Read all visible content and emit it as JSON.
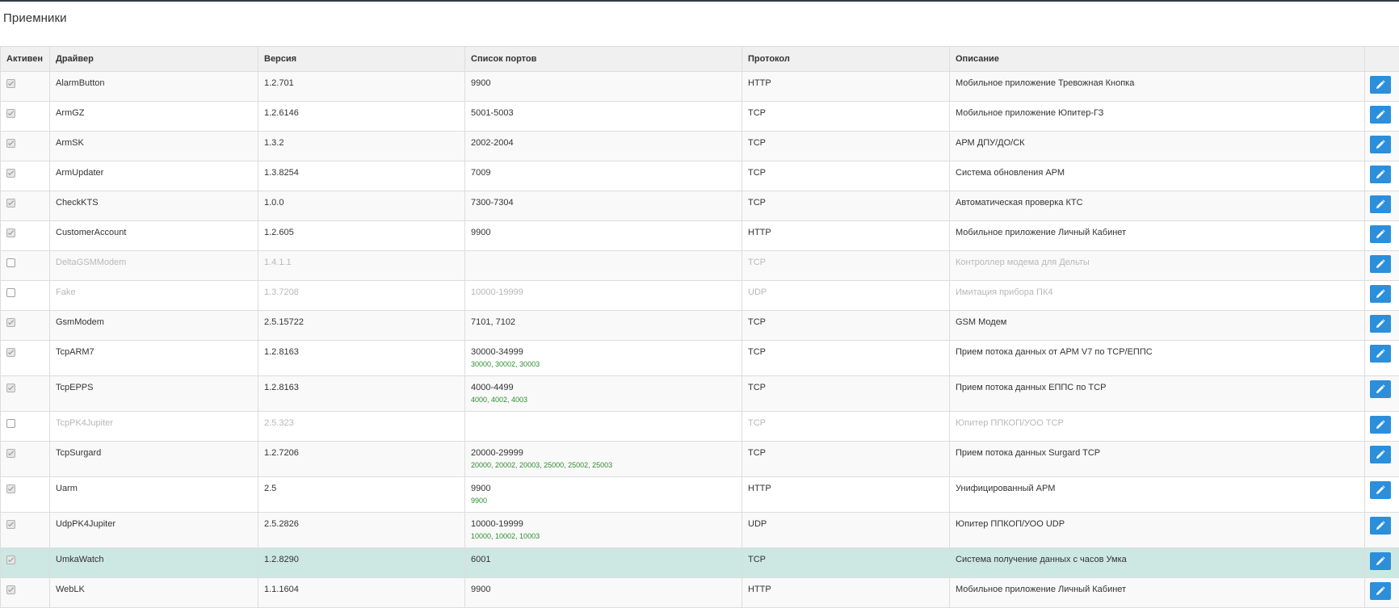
{
  "page": {
    "title": "Приемники"
  },
  "columns": [
    "Активен",
    "Драйвер",
    "Версия",
    "Список портов",
    "Протокол",
    "Описание",
    ""
  ],
  "colors": {
    "accent": "#2b8fdb",
    "highlight_row": "#cde7e3",
    "ports_active": "#2e8b2e"
  },
  "rows": [
    {
      "active": true,
      "driver": "AlarmButton",
      "version": "1.2.701",
      "ports": "9900",
      "ports_active": "",
      "protocol": "HTTP",
      "description": "Мобильное приложение Тревожная Кнопка"
    },
    {
      "active": true,
      "driver": "ArmGZ",
      "version": "1.2.6146",
      "ports": "5001-5003",
      "ports_active": "",
      "protocol": "TCP",
      "description": "Мобильное приложение Юпитер-ГЗ"
    },
    {
      "active": true,
      "driver": "ArmSK",
      "version": "1.3.2",
      "ports": "2002-2004",
      "ports_active": "",
      "protocol": "TCP",
      "description": "АРМ ДПУ/ДО/СК"
    },
    {
      "active": true,
      "driver": "ArmUpdater",
      "version": "1.3.8254",
      "ports": "7009",
      "ports_active": "",
      "protocol": "TCP",
      "description": "Система обновления АРМ"
    },
    {
      "active": true,
      "driver": "CheckKTS",
      "version": "1.0.0",
      "ports": "7300-7304",
      "ports_active": "",
      "protocol": "TCP",
      "description": "Автоматическая проверка КТС"
    },
    {
      "active": true,
      "driver": "CustomerAccount",
      "version": "1.2.605",
      "ports": "9900",
      "ports_active": "",
      "protocol": "HTTP",
      "description": "Мобильное приложение Личный Кабинет"
    },
    {
      "active": false,
      "driver": "DeltaGSMModem",
      "version": "1.4.1.1",
      "ports": "",
      "ports_active": "",
      "protocol": "TCP",
      "description": "Контроллер модема для Дельты"
    },
    {
      "active": false,
      "driver": "Fake",
      "version": "1.3.7208",
      "ports": "10000-19999",
      "ports_active": "",
      "protocol": "UDP",
      "description": "Имитация прибора ПК4"
    },
    {
      "active": true,
      "driver": "GsmModem",
      "version": "2.5.15722",
      "ports": "7101, 7102",
      "ports_active": "",
      "protocol": "TCP",
      "description": "GSM Модем"
    },
    {
      "active": true,
      "driver": "TcpARM7",
      "version": "1.2.8163",
      "ports": "30000-34999",
      "ports_active": "30000, 30002, 30003",
      "protocol": "TCP",
      "description": "Прием потока данных от АРМ V7 по TCP/ЕППС"
    },
    {
      "active": true,
      "driver": "TcpEPPS",
      "version": "1.2.8163",
      "ports": "4000-4499",
      "ports_active": "4000, 4002, 4003",
      "protocol": "TCP",
      "description": "Прием потока данных ЕППС по TCP"
    },
    {
      "active": false,
      "driver": "TcpPK4Jupiter",
      "version": "2.5.323",
      "ports": "",
      "ports_active": "",
      "protocol": "TCP",
      "description": "Юпитер ППКОП/УОО TCP"
    },
    {
      "active": true,
      "driver": "TcpSurgard",
      "version": "1.2.7206",
      "ports": "20000-29999",
      "ports_active": "20000, 20002, 20003, 25000, 25002, 25003",
      "protocol": "TCP",
      "description": "Прием потока данных Surgard TCP"
    },
    {
      "active": true,
      "driver": "Uarm",
      "version": "2.5",
      "ports": "9900",
      "ports_active": "9900",
      "protocol": "HTTP",
      "description": "Унифицированный АРМ"
    },
    {
      "active": true,
      "driver": "UdpPK4Jupiter",
      "version": "2.5.2826",
      "ports": "10000-19999",
      "ports_active": "10000, 10002, 10003",
      "protocol": "UDP",
      "description": "Юпитер ППКОП/УОО UDP"
    },
    {
      "active": true,
      "driver": "UmkaWatch",
      "version": "1.2.8290",
      "ports": "6001",
      "ports_active": "",
      "protocol": "TCP",
      "description": "Система получение данных с часов Умка",
      "highlight": true
    },
    {
      "active": true,
      "driver": "WebLK",
      "version": "1.1.1604",
      "ports": "9900",
      "ports_active": "",
      "protocol": "HTTP",
      "description": "Мобильное приложение Личный Кабинет"
    }
  ]
}
